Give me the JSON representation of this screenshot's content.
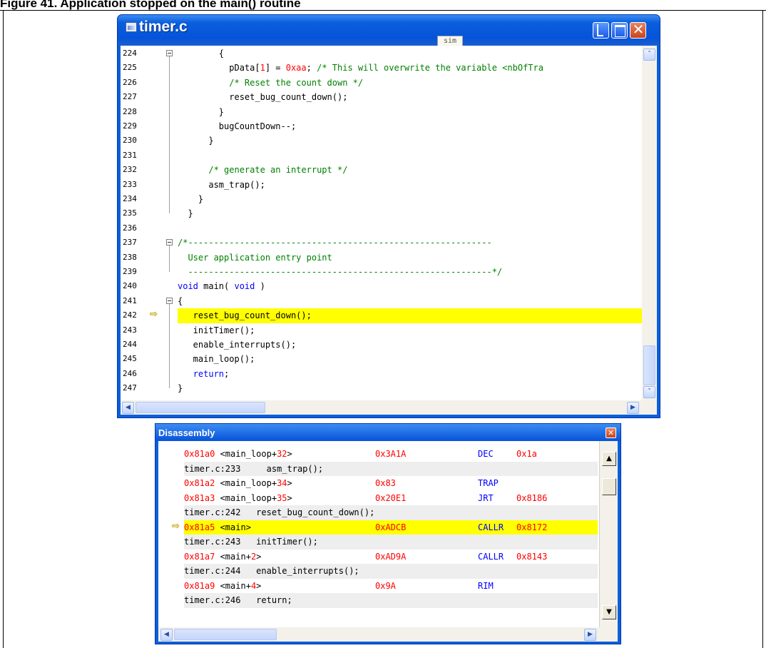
{
  "figure": {
    "heading": "Figure 41. Application stopped on the main() routine"
  },
  "editor": {
    "title": "timer.c",
    "tooltip": "sim",
    "controls": {
      "minimize": "_",
      "maximize": "□",
      "close": "✕"
    },
    "exec_arrow": "⇨",
    "line_numbers": [
      "224",
      "225",
      "226",
      "227",
      "228",
      "229",
      "230",
      "231",
      "232",
      "233",
      "234",
      "235",
      "236",
      "237",
      "238",
      "239",
      "240",
      "241",
      "242",
      "243",
      "244",
      "245",
      "246",
      "247"
    ],
    "current_line": "242",
    "lines": [
      [
        {
          "t": "        {"
        }
      ],
      [
        {
          "t": "          pData["
        },
        {
          "t": "1",
          "c": "num"
        },
        {
          "t": "] = "
        },
        {
          "t": "0xaa",
          "c": "num"
        },
        {
          "t": "; "
        },
        {
          "t": "/* This will overwrite the variable <nbOfTra",
          "c": "com"
        }
      ],
      [
        {
          "t": "          "
        },
        {
          "t": "/* Reset the count down */",
          "c": "com"
        }
      ],
      [
        {
          "t": "          reset_bug_count_down();"
        }
      ],
      [
        {
          "t": "        }"
        }
      ],
      [
        {
          "t": "        bugCountDown--;"
        }
      ],
      [
        {
          "t": "      }"
        }
      ],
      [
        {
          "t": ""
        }
      ],
      [
        {
          "t": "      "
        },
        {
          "t": "/* generate an interrupt */",
          "c": "com"
        }
      ],
      [
        {
          "t": "      asm_trap();"
        }
      ],
      [
        {
          "t": "    }"
        }
      ],
      [
        {
          "t": "  }"
        }
      ],
      [
        {
          "t": ""
        }
      ],
      [
        {
          "t": "/*-----------------------------------------------------------",
          "c": "com"
        }
      ],
      [
        {
          "t": "  User application entry point",
          "c": "com"
        }
      ],
      [
        {
          "t": "  -----------------------------------------------------------*/",
          "c": "com"
        }
      ],
      [
        {
          "t": "void",
          "c": "kw"
        },
        {
          "t": " main( "
        },
        {
          "t": "void",
          "c": "kw"
        },
        {
          "t": " )"
        }
      ],
      [
        {
          "t": "{"
        }
      ],
      [
        {
          "t": "   reset_bug_count_down();"
        }
      ],
      [
        {
          "t": "   initTimer();"
        }
      ],
      [
        {
          "t": "   enable_interrupts();"
        }
      ],
      [
        {
          "t": "   main_loop();"
        }
      ],
      [
        {
          "t": "   "
        },
        {
          "t": "return",
          "c": "kw"
        },
        {
          "t": ";"
        }
      ],
      [
        {
          "t": "}"
        }
      ]
    ]
  },
  "disassembly": {
    "title": "Disassembly",
    "close": "✕",
    "exec_arrow": "⇨",
    "rows": [
      {
        "kind": "asm",
        "addr": "0x81a0",
        "sym": " <main_loop+",
        "off": "32",
        "end": ">",
        "op": "0x3A1A",
        "mn": "DEC",
        "arg": "0x1a"
      },
      {
        "kind": "src",
        "text": "timer.c:233     asm_trap();"
      },
      {
        "kind": "asm",
        "addr": "0x81a2",
        "sym": " <main_loop+",
        "off": "34",
        "end": ">",
        "op": "0x83",
        "mn": "TRAP",
        "arg": ""
      },
      {
        "kind": "asm",
        "addr": "0x81a3",
        "sym": " <main_loop+",
        "off": "35",
        "end": ">",
        "op": "0x20E1",
        "mn": "JRT",
        "arg": "0x8186"
      },
      {
        "kind": "src",
        "text": "timer.c:242   reset_bug_count_down();"
      },
      {
        "kind": "asm",
        "addr": "0x81a5",
        "sym": " <main>",
        "off": "",
        "end": "",
        "op": "0xADCB",
        "mn": "CALLR",
        "arg": "0x8172",
        "current": true
      },
      {
        "kind": "src",
        "text": "timer.c:243   initTimer();"
      },
      {
        "kind": "asm",
        "addr": "0x81a7",
        "sym": " <main+",
        "off": "2",
        "end": ">",
        "op": "0xAD9A",
        "mn": "CALLR",
        "arg": "0x8143"
      },
      {
        "kind": "src",
        "text": "timer.c:244   enable_interrupts();"
      },
      {
        "kind": "asm",
        "addr": "0x81a9",
        "sym": " <main+",
        "off": "4",
        "end": ">",
        "op": "0x9A",
        "mn": "RIM",
        "arg": ""
      },
      {
        "kind": "src",
        "text": "timer.c:246   return;"
      }
    ]
  },
  "scroll_glyphs": {
    "up": "▲",
    "down": "▼",
    "left": "◀",
    "right": "▶",
    "up_small": "˄",
    "down_small": "˅"
  }
}
